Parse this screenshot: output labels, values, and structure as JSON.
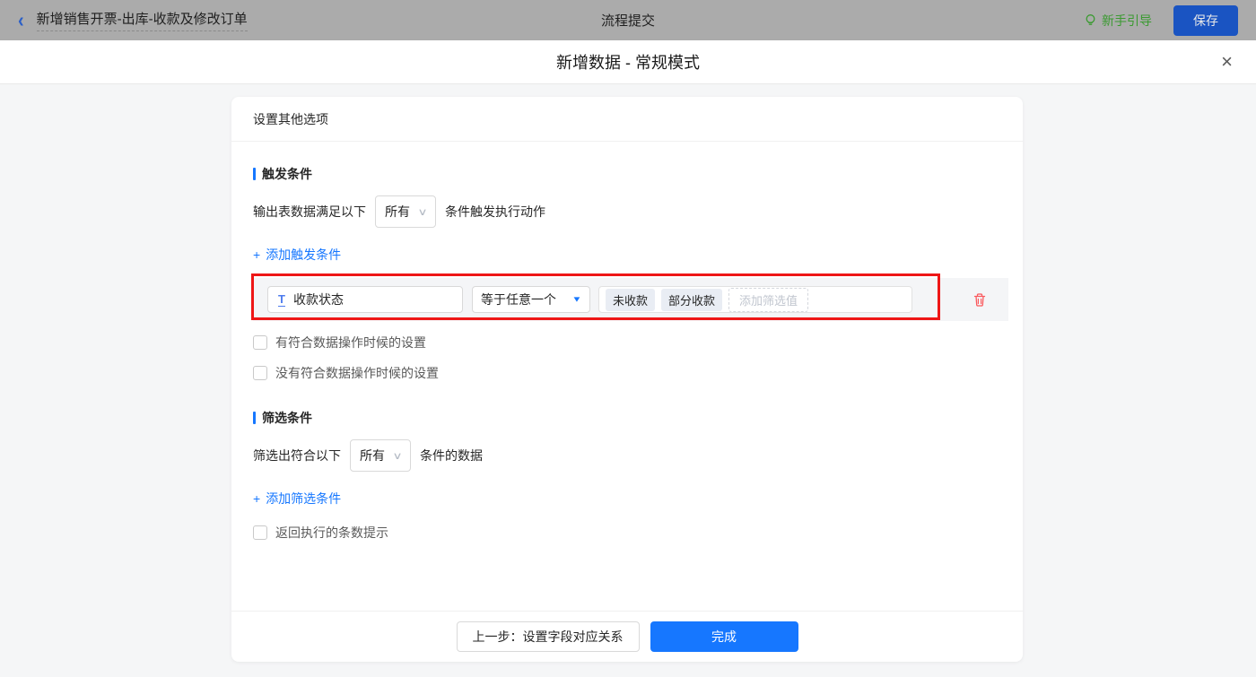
{
  "icons": {
    "back": "‹",
    "close": "×",
    "plus": "+",
    "select_chevron": "∨",
    "caret_down": "▼",
    "field_type": "T"
  },
  "top_bar": {
    "flow_title": "新增销售开票-出库-收款及修改订单",
    "center_title": "流程提交",
    "guide_label": "新手引导",
    "save_label": "保存"
  },
  "modal": {
    "title": "新增数据 - 常规模式",
    "panel": {
      "header": "设置其他选项",
      "trigger_section": {
        "title": "触发条件",
        "sentence_prefix": "输出表数据满足以下",
        "match_select_value": "所有",
        "sentence_suffix": "条件触发执行动作",
        "add_link": "添加触发条件",
        "condition_row": {
          "field": "收款状态",
          "operator": "等于任意一个",
          "values": [
            "未收款",
            "部分收款"
          ],
          "value_placeholder": "添加筛选值"
        },
        "checkboxes": [
          "有符合数据操作时候的设置",
          "没有符合数据操作时候的设置"
        ]
      },
      "filter_section": {
        "title": "筛选条件",
        "sentence_prefix": "筛选出符合以下",
        "match_select_value": "所有",
        "sentence_suffix": "条件的数据",
        "add_link": "添加筛选条件",
        "checkbox": "返回执行的条数提示"
      },
      "footer": {
        "prev_label": "上一步：设置字段对应关系",
        "done_label": "完成"
      }
    }
  },
  "colors": {
    "accent_blue": "#1677ff",
    "highlight_red": "#ee1616",
    "guide_green": "#3a9a30",
    "danger_red": "#fa5a5e",
    "topbar_dimmed": "#ababab"
  }
}
